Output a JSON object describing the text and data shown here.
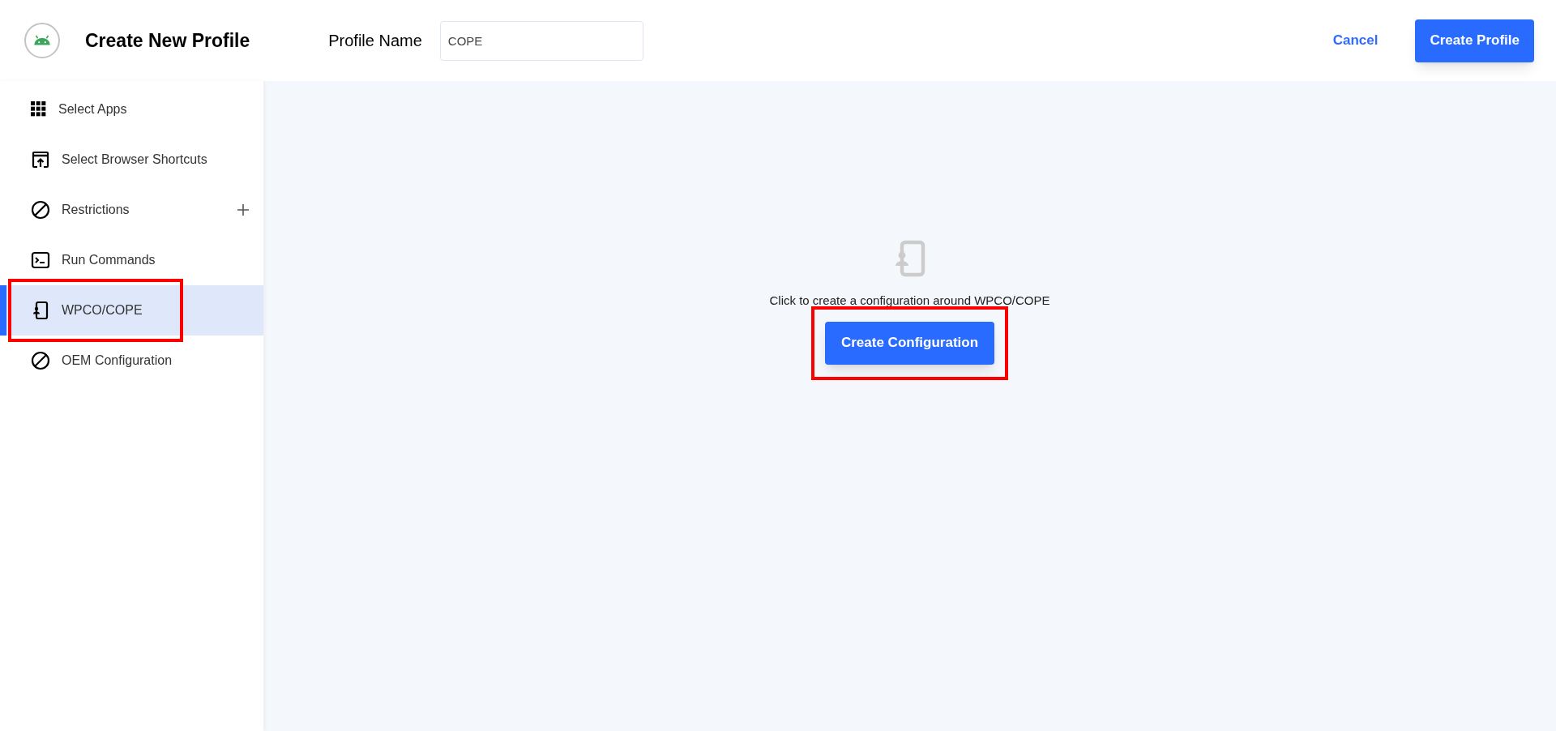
{
  "header": {
    "title": "Create New Profile",
    "profile_name": {
      "label": "Profile Name",
      "value": "COPE"
    },
    "cancel": "Cancel",
    "create": "Create Profile"
  },
  "sidebar": {
    "items": [
      {
        "kind": "grid",
        "label": "Select Apps",
        "selected": false,
        "expandable": false,
        "annotated": false
      },
      {
        "kind": "shortcut",
        "label": "Select Browser Shortcuts",
        "selected": false,
        "expandable": false,
        "annotated": false
      },
      {
        "kind": "blocked",
        "label": "Restrictions",
        "selected": false,
        "expandable": true,
        "annotated": false
      },
      {
        "kind": "terminal",
        "label": "Run Commands",
        "selected": false,
        "expandable": false,
        "annotated": false
      },
      {
        "kind": "device",
        "label": "WPCO/COPE",
        "selected": true,
        "expandable": false,
        "annotated": true
      },
      {
        "kind": "blocked",
        "label": "OEM Configuration",
        "selected": false,
        "expandable": false,
        "annotated": false
      }
    ]
  },
  "empty_state": {
    "message": "Click to create a configuration around WPCO/COPE",
    "button": "Create Configuration",
    "annotated": true
  }
}
